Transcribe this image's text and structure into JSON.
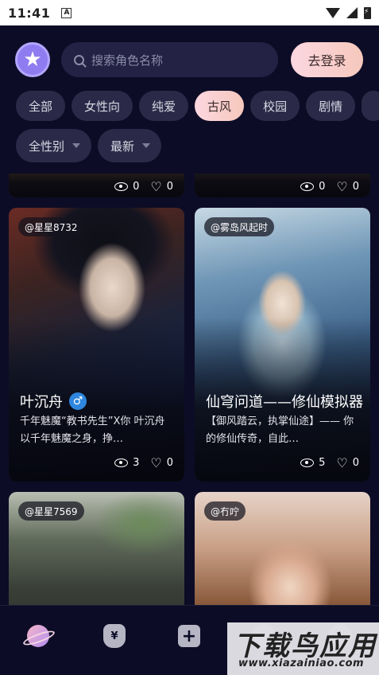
{
  "status_bar": {
    "time": "11:41",
    "notif_glyph": "A"
  },
  "header": {
    "logo_icon": "star-face-icon",
    "search_placeholder": "搜索角色名称",
    "login_label": "去登录"
  },
  "categories": [
    "全部",
    "女性向",
    "纯爱",
    "古风",
    "校园",
    "剧情"
  ],
  "active_category": "古风",
  "filters": {
    "gender": "全性别",
    "sort": "最新"
  },
  "top_row_stats": [
    {
      "views": "0",
      "likes": "0"
    },
    {
      "views": "0",
      "likes": "0"
    }
  ],
  "cards": [
    {
      "author": "@星星8732",
      "name": "叶沉舟",
      "gender_icon": "♂",
      "desc": "千年魅魔“教书先生”X你 叶沉舟以千年魅魔之身，挣…",
      "views": "3",
      "likes": "0"
    },
    {
      "author": "@雾岛风起时",
      "name": "仙穹问道——修仙模拟器",
      "desc": "【御风踏云，执掌仙途】—— 你的修仙传奇，自此…",
      "views": "5",
      "likes": "0"
    },
    {
      "author": "@星星7569"
    },
    {
      "author": "@冇咛"
    }
  ],
  "bottom_nav": [
    "planet-icon",
    "money-bag-icon",
    "plus-icon"
  ],
  "watermark": {
    "title": "下载鸟应用",
    "url": "www.xiazainiao.com"
  },
  "colors": {
    "background": "#0d0c26",
    "chip": "#2a2a48",
    "accent_pink": "#fcd7e0"
  }
}
